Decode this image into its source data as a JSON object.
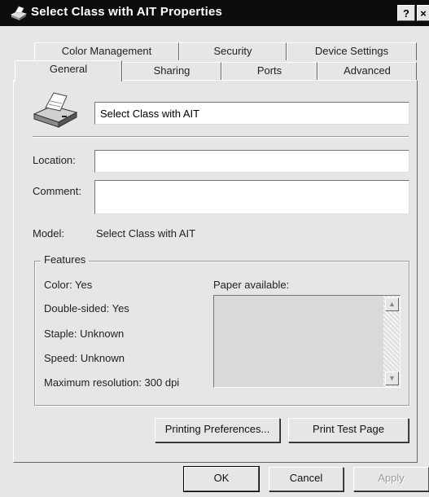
{
  "window": {
    "title": "Select Class with AIT Properties",
    "help_label": "?",
    "close_label": "×"
  },
  "tabs": {
    "row1": [
      {
        "label": "Color Management"
      },
      {
        "label": "Security"
      },
      {
        "label": "Device Settings"
      }
    ],
    "row2": [
      {
        "label": "General",
        "active": true
      },
      {
        "label": "Sharing"
      },
      {
        "label": "Ports"
      },
      {
        "label": "Advanced"
      }
    ]
  },
  "general": {
    "printer_name": "Select Class with AIT",
    "location_label": "Location:",
    "location_value": "",
    "comment_label": "Comment:",
    "comment_value": "",
    "model_label": "Model:",
    "model_value": "Select Class with AIT"
  },
  "features": {
    "title": "Features",
    "color": "Color: Yes",
    "double_sided": "Double-sided: Yes",
    "staple": "Staple: Unknown",
    "speed": "Speed: Unknown",
    "max_resolution": "Maximum resolution: 300 dpi",
    "paper_label": "Paper available:",
    "paper_items": []
  },
  "buttons": {
    "printing_preferences": "Printing Preferences...",
    "print_test_page": "Print Test Page",
    "ok": "OK",
    "cancel": "Cancel",
    "apply": "Apply"
  },
  "colors": {
    "titlebar": "#0d0d0d",
    "face": "#e6e6e6"
  }
}
